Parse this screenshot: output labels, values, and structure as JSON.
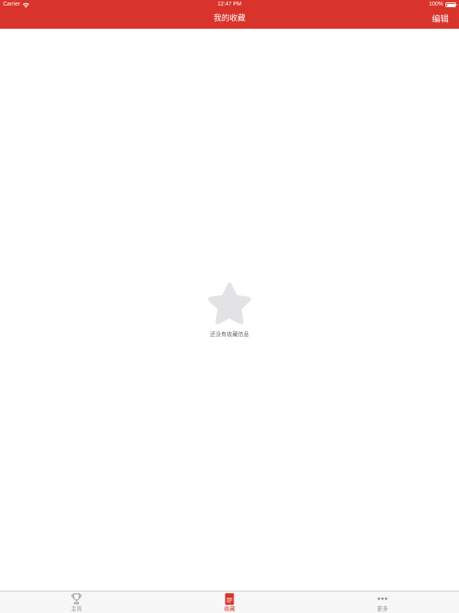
{
  "status_bar": {
    "carrier": "Carrier",
    "time": "12:47 PM",
    "battery": "100%"
  },
  "nav": {
    "title": "我的收藏",
    "edit_label": "编辑"
  },
  "empty_state": {
    "icon": "star-icon",
    "message": "还没有收藏信息"
  },
  "tabbar": {
    "tabs": [
      {
        "label": "主页",
        "icon": "trophy-icon",
        "active": false
      },
      {
        "label": "收藏",
        "icon": "document-icon",
        "active": true
      },
      {
        "label": "更多",
        "icon": "more-dots-icon",
        "active": false
      }
    ]
  },
  "colors": {
    "accent": "#d9342b",
    "tab_inactive": "#8e8e93",
    "empty_icon": "#e3e3e5"
  }
}
